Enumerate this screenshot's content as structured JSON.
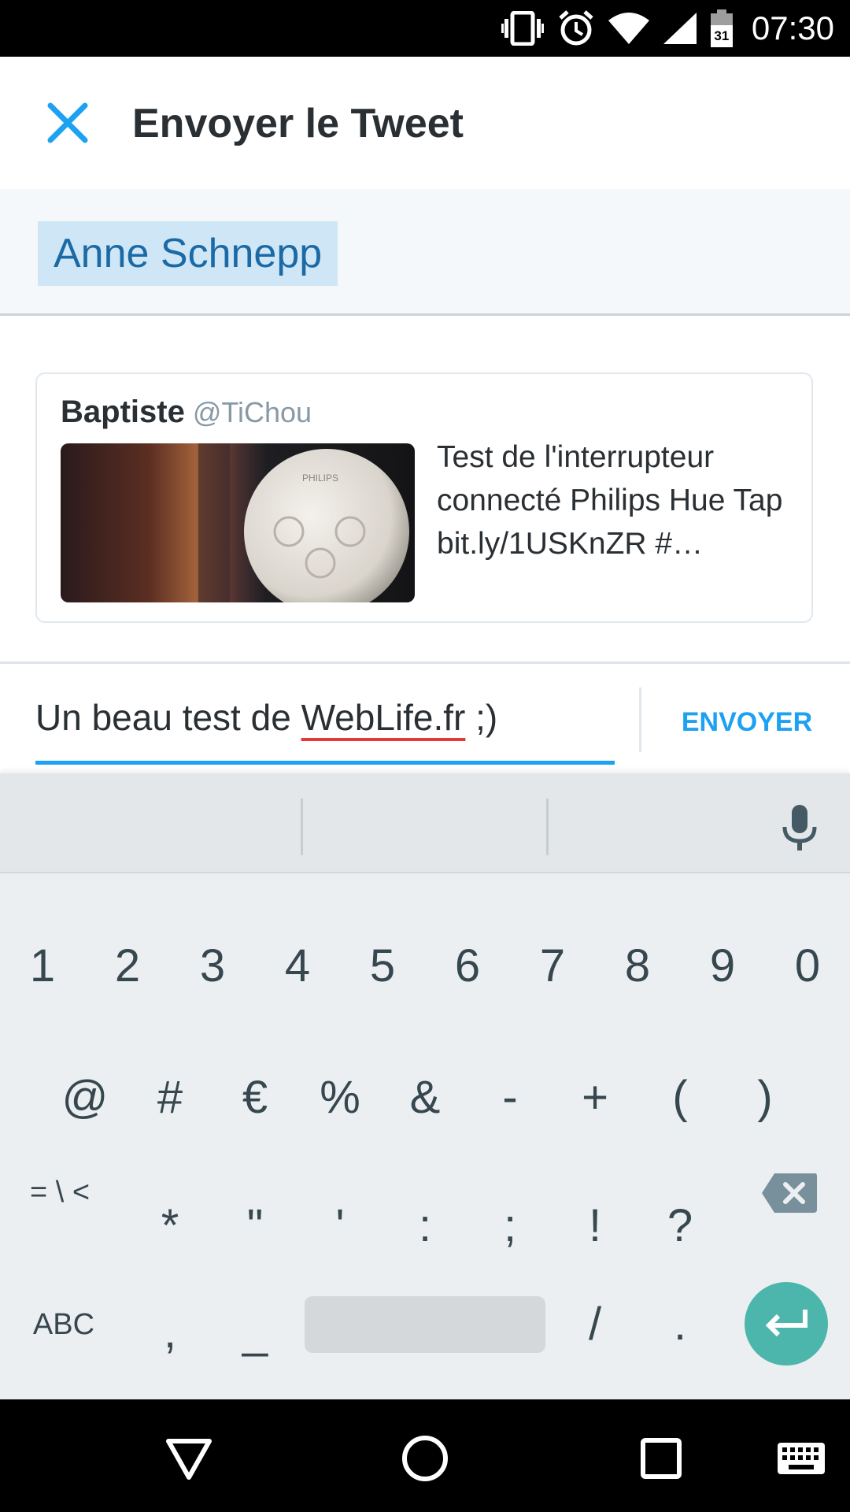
{
  "status_bar": {
    "time": "07:30",
    "calendar_day": "31",
    "icons": [
      "vibrate-icon",
      "alarm-icon",
      "wifi-icon",
      "signal-icon",
      "battery-icon"
    ]
  },
  "header": {
    "title": "Envoyer le Tweet",
    "close_icon": "close-icon"
  },
  "recipient": {
    "name": "Anne Schnepp"
  },
  "tweet": {
    "author_name": "Baptiste",
    "author_handle": "@TiChou",
    "text": "Test de l'interrupteur connecté Philips Hue Tap bit.ly/1USKnZR #…",
    "image_label": "PHILIPS"
  },
  "compose": {
    "text_before": "Un beau test de ",
    "text_misspelled": "WebLife.fr",
    "text_after": " ;)",
    "send_label": "ENVOYER"
  },
  "keyboard": {
    "row1": [
      "1",
      "2",
      "3",
      "4",
      "5",
      "6",
      "7",
      "8",
      "9",
      "0"
    ],
    "row2": [
      "@",
      "#",
      "€",
      "%",
      "&",
      "-",
      "+",
      "(",
      ")"
    ],
    "row3": [
      "= \\ <",
      "*",
      "\"",
      "'",
      ":",
      ";",
      "!",
      "?"
    ],
    "row4_left": "ABC",
    "row4_keys": [
      ",",
      "_",
      "/",
      "."
    ],
    "mic_icon": "microphone-icon",
    "delete_icon": "backspace-icon",
    "enter_icon": "enter-icon"
  },
  "nav_bar": {
    "icons": [
      "back-icon",
      "home-icon",
      "recents-icon",
      "keyboard-switch-icon"
    ]
  },
  "colors": {
    "accent": "#1da1f2",
    "chip_bg": "#cfe6f6",
    "chip_text": "#1b6aa5",
    "enter_key": "#4db6ac",
    "spell_underline": "#e53935"
  }
}
